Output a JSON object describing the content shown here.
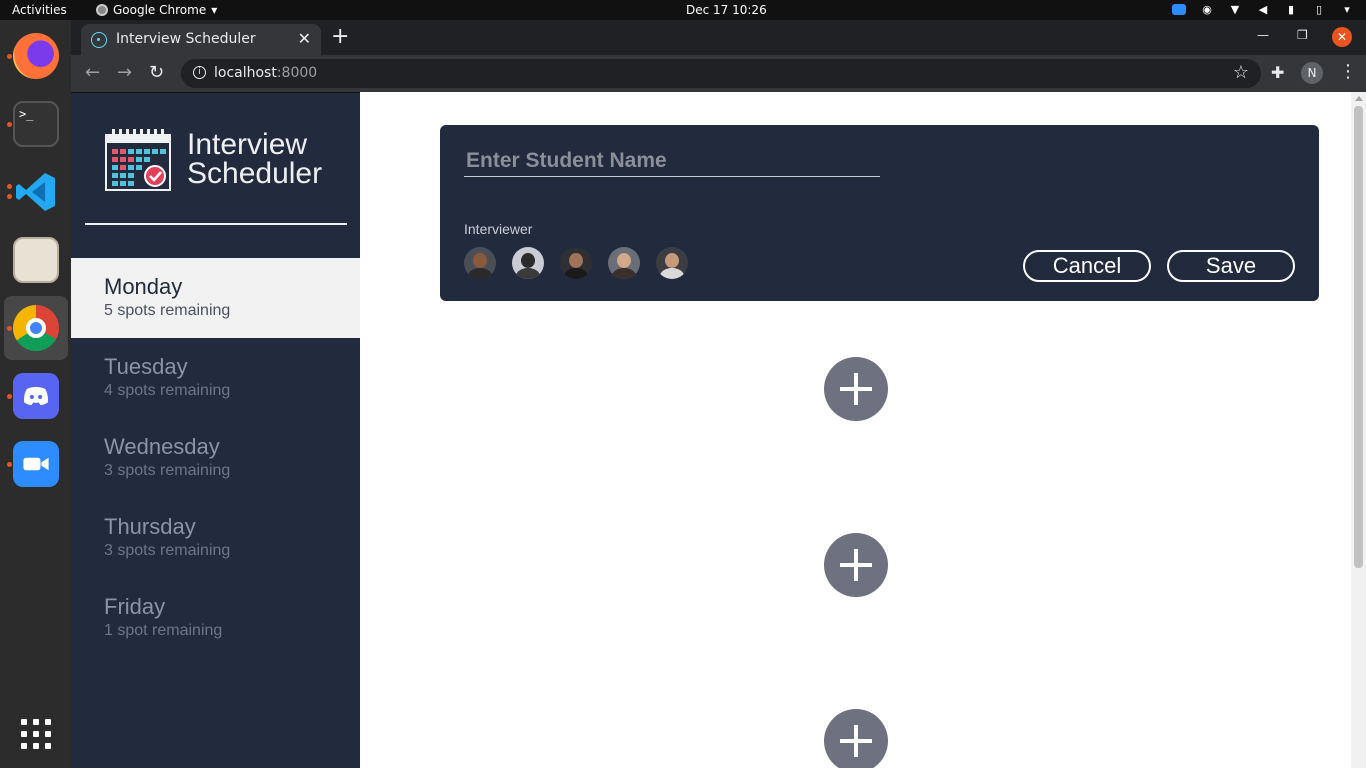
{
  "system": {
    "activities": "Activities",
    "app_name": "Google Chrome",
    "clock": "Dec 17  10:26"
  },
  "dock": {
    "apps": [
      "firefox",
      "terminal",
      "vscode",
      "files",
      "chrome",
      "discord",
      "zoom",
      "show-applications"
    ],
    "terminal_prompt": ">_"
  },
  "browser": {
    "tab_title": "Interview Scheduler",
    "url_host": "localhost",
    "url_port": ":8000",
    "profile_initial": "N"
  },
  "sidebar": {
    "brand_line1": "Interview",
    "brand_line2": "Scheduler",
    "days": [
      {
        "name": "Monday",
        "spots": "5 spots remaining",
        "selected": true
      },
      {
        "name": "Tuesday",
        "spots": "4 spots remaining",
        "selected": false
      },
      {
        "name": "Wednesday",
        "spots": "3 spots remaining",
        "selected": false
      },
      {
        "name": "Thursday",
        "spots": "3 spots remaining",
        "selected": false
      },
      {
        "name": "Friday",
        "spots": "1 spot remaining",
        "selected": false
      }
    ]
  },
  "form": {
    "student_placeholder": "Enter Student Name",
    "student_value": "",
    "interviewer_label": "Interviewer",
    "cancel_label": "Cancel",
    "save_label": "Save"
  },
  "colors": {
    "sidebar_bg": "#222a3d",
    "add_button": "#6d7180",
    "selected_day_bg": "#f2f2f2"
  }
}
